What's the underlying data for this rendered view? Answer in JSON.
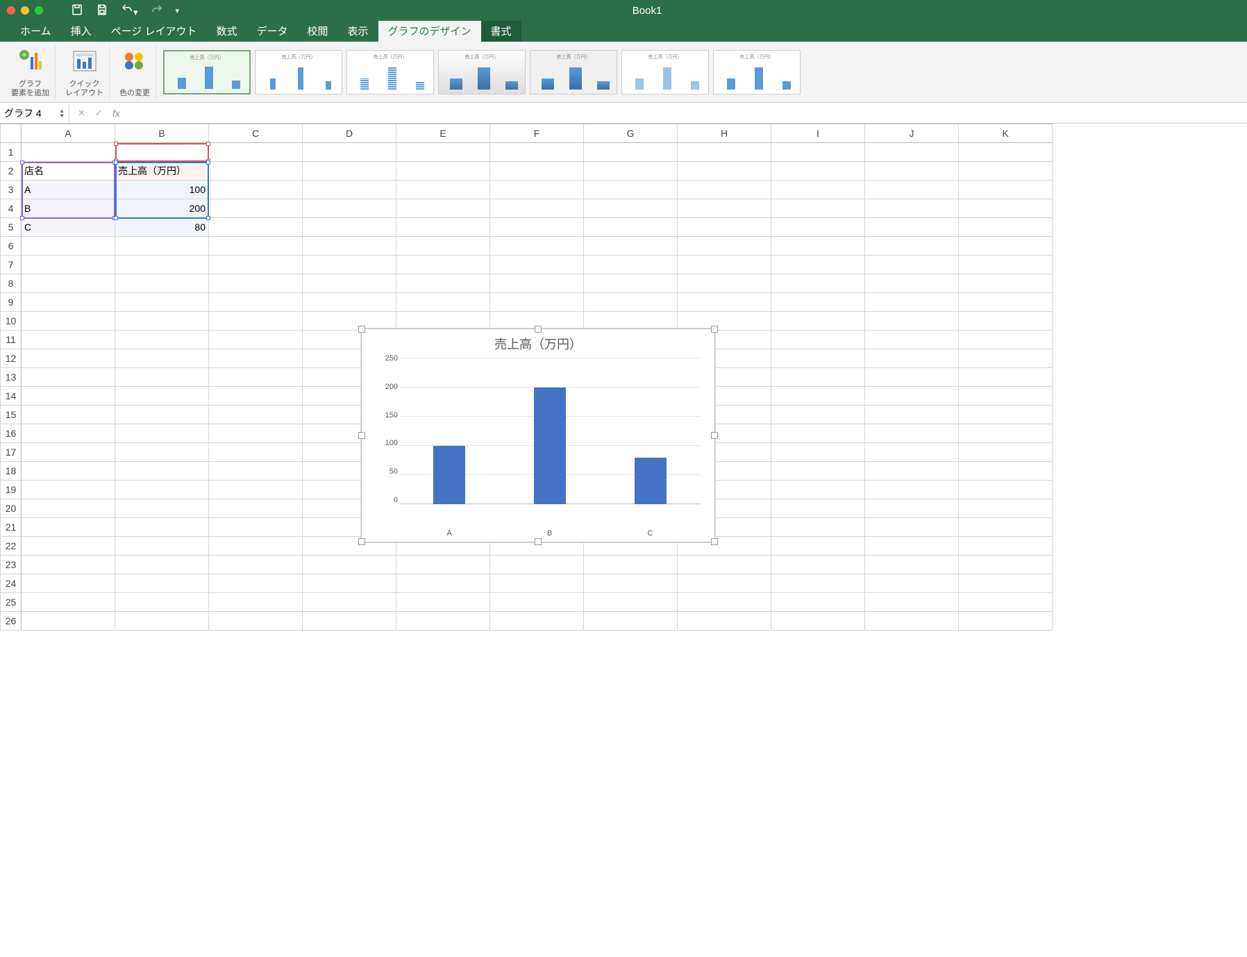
{
  "window": {
    "title": "Book1"
  },
  "tabs": [
    "ホーム",
    "挿入",
    "ページ レイアウト",
    "数式",
    "データ",
    "校閲",
    "表示",
    "グラフのデザイン",
    "書式"
  ],
  "active_tab_index": 7,
  "ribbon": {
    "add_element": "グラフ\n要素を追加",
    "quick_layout": "クイック\nレイアウト",
    "change_colors": "色の変更",
    "thumb_title": "売上高（万円）"
  },
  "namebox": "グラフ 4",
  "formula": "",
  "columns": [
    "A",
    "B",
    "C",
    "D",
    "E",
    "F",
    "G",
    "H",
    "I",
    "J",
    "K"
  ],
  "row_count": 26,
  "cells": {
    "A2": "店名",
    "B2": "売上高（万円）",
    "A3": "A",
    "B3": "100",
    "A4": "B",
    "B4": "200",
    "A5": "C",
    "B5": "80"
  },
  "chart_data": {
    "type": "bar",
    "title": "売上高（万円）",
    "categories": [
      "A",
      "B",
      "C"
    ],
    "values": [
      100,
      200,
      80
    ],
    "ylim": [
      0,
      250
    ],
    "yticks": [
      0,
      50,
      100,
      150,
      200,
      250
    ],
    "xlabel": "",
    "ylabel": ""
  }
}
